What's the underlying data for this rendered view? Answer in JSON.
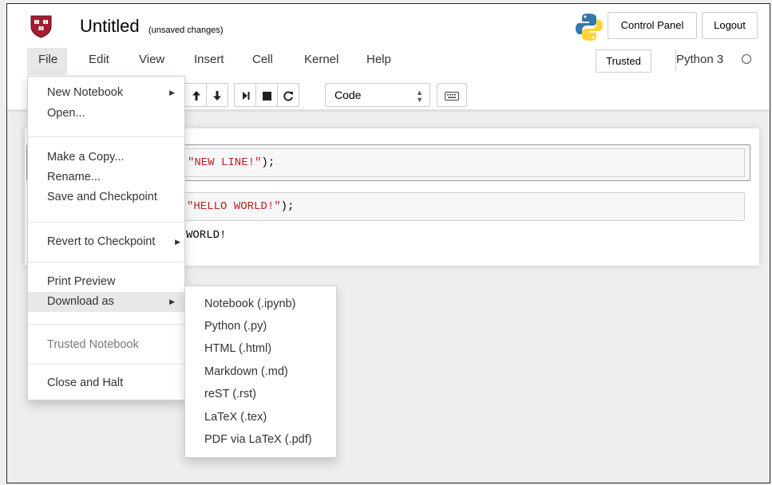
{
  "header": {
    "notebook_title": "Untitled",
    "save_status": "(unsaved changes)",
    "control_panel_label": "Control Panel",
    "logout_label": "Logout"
  },
  "menubar": {
    "items": [
      "File",
      "Edit",
      "View",
      "Insert",
      "Cell",
      "Kernel",
      "Help"
    ],
    "trusted_label": "Trusted",
    "kernel_name": "Python 3"
  },
  "toolbar": {
    "icons": [
      "arrow-up-icon",
      "arrow-down-icon",
      "run-icon",
      "stop-icon",
      "restart-icon",
      "keyboard-icon"
    ],
    "cell_type": "Code"
  },
  "cells": [
    {
      "code": "\"NEW LINE!\");",
      "string": "\"NEW LINE!\"",
      "suffix": ");"
    },
    {
      "code": "\"HELLO WORLD!\");",
      "string": "\"HELLO WORLD!\"",
      "suffix": ");",
      "output": "WORLD!"
    }
  ],
  "file_menu": {
    "new_notebook": "New Notebook",
    "open": "Open...",
    "make_copy": "Make a Copy...",
    "rename": "Rename...",
    "save_checkpoint": "Save and Checkpoint",
    "revert_checkpoint": "Revert to Checkpoint",
    "print_preview": "Print Preview",
    "download_as": "Download as",
    "trusted_notebook": "Trusted Notebook",
    "close_halt": "Close and Halt"
  },
  "download_menu": {
    "items": [
      "Notebook (.ipynb)",
      "Python (.py)",
      "HTML (.html)",
      "Markdown (.md)",
      "reST (.rst)",
      "LaTeX (.tex)",
      "PDF via LaTeX (.pdf)"
    ]
  },
  "colors": {
    "string_red": "#ba2121",
    "menu_hover": "#e8e8e8",
    "python_blue": "#3776ab",
    "python_yellow": "#ffd43b",
    "crest_red": "#a51c30"
  }
}
